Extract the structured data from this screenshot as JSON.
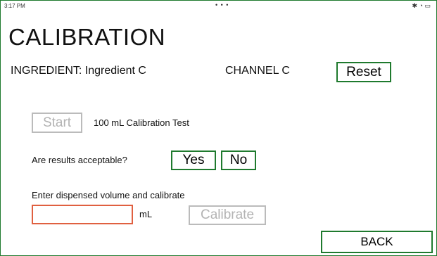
{
  "status_bar": {
    "time": "3:17 PM",
    "dots": "• • •"
  },
  "page": {
    "title": "CALIBRATION"
  },
  "ingredient": {
    "text": "INGREDIENT: Ingredient C"
  },
  "channel": {
    "text": "CHANNEL C"
  },
  "buttons": {
    "reset": "Reset",
    "start": "Start",
    "yes": "Yes",
    "no": "No",
    "calibrate": "Calibrate",
    "back": "BACK"
  },
  "test": {
    "label": "100 mL Calibration Test"
  },
  "acceptance": {
    "question": "Are results acceptable?"
  },
  "volume": {
    "label": "Enter dispensed volume and calibrate",
    "value": "",
    "unit": "mL"
  },
  "colors": {
    "accent_border": "#1f7a2e",
    "input_border": "#e06040",
    "disabled": "#bbbbbb"
  },
  "icons": [
    "bluetooth-icon",
    "wifi-icon",
    "battery-icon"
  ]
}
